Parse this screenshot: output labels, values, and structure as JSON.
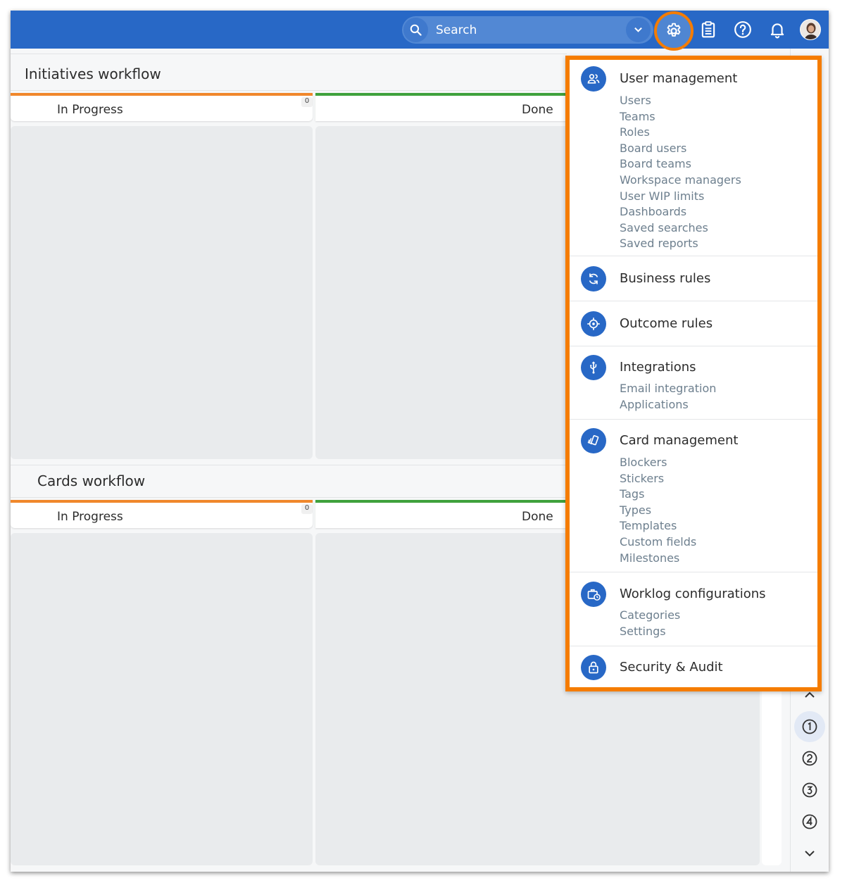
{
  "topbar": {
    "search_label": "Search",
    "accent": "#2868c6",
    "highlight": "#f57c00",
    "icons": [
      "search-icon",
      "chevron-down-icon",
      "gear-icon",
      "clipboard-icon",
      "help-icon",
      "bell-icon",
      "avatar"
    ]
  },
  "board": {
    "lanes": [
      {
        "title": "Initiatives workflow",
        "columns": [
          {
            "label": "In Progress",
            "count": "0",
            "color": "#f0872b"
          },
          {
            "label": "Done",
            "color": "#3fa13c"
          }
        ]
      },
      {
        "title": "Cards workflow",
        "columns": [
          {
            "label": "In Progress",
            "count": "0",
            "color": "#f0872b"
          },
          {
            "label": "Done",
            "color": "#3fa13c"
          }
        ]
      }
    ]
  },
  "rail": {
    "items": [
      "up-icon",
      "1",
      "2",
      "3",
      "4",
      "down-icon"
    ]
  },
  "menu": {
    "sections": [
      {
        "title": "User management",
        "icon": "users-icon",
        "items": [
          "Users",
          "Teams",
          "Roles",
          "Board users",
          "Board teams",
          "Workspace managers",
          "User WIP limits",
          "Dashboards",
          "Saved searches",
          "Saved reports"
        ]
      },
      {
        "title": "Business rules",
        "icon": "refresh-icon",
        "items": []
      },
      {
        "title": "Outcome rules",
        "icon": "target-icon",
        "items": []
      },
      {
        "title": "Integrations",
        "icon": "usb-icon",
        "items": [
          "Email integration",
          "Applications"
        ]
      },
      {
        "title": "Card management",
        "icon": "cards-icon",
        "items": [
          "Blockers",
          "Stickers",
          "Tags",
          "Types",
          "Templates",
          "Custom fields",
          "Milestones"
        ]
      },
      {
        "title": "Worklog configurations",
        "icon": "briefcase-clock-icon",
        "items": [
          "Categories",
          "Settings"
        ]
      },
      {
        "title": "Security & Audit",
        "icon": "lock-icon",
        "items": []
      }
    ]
  }
}
